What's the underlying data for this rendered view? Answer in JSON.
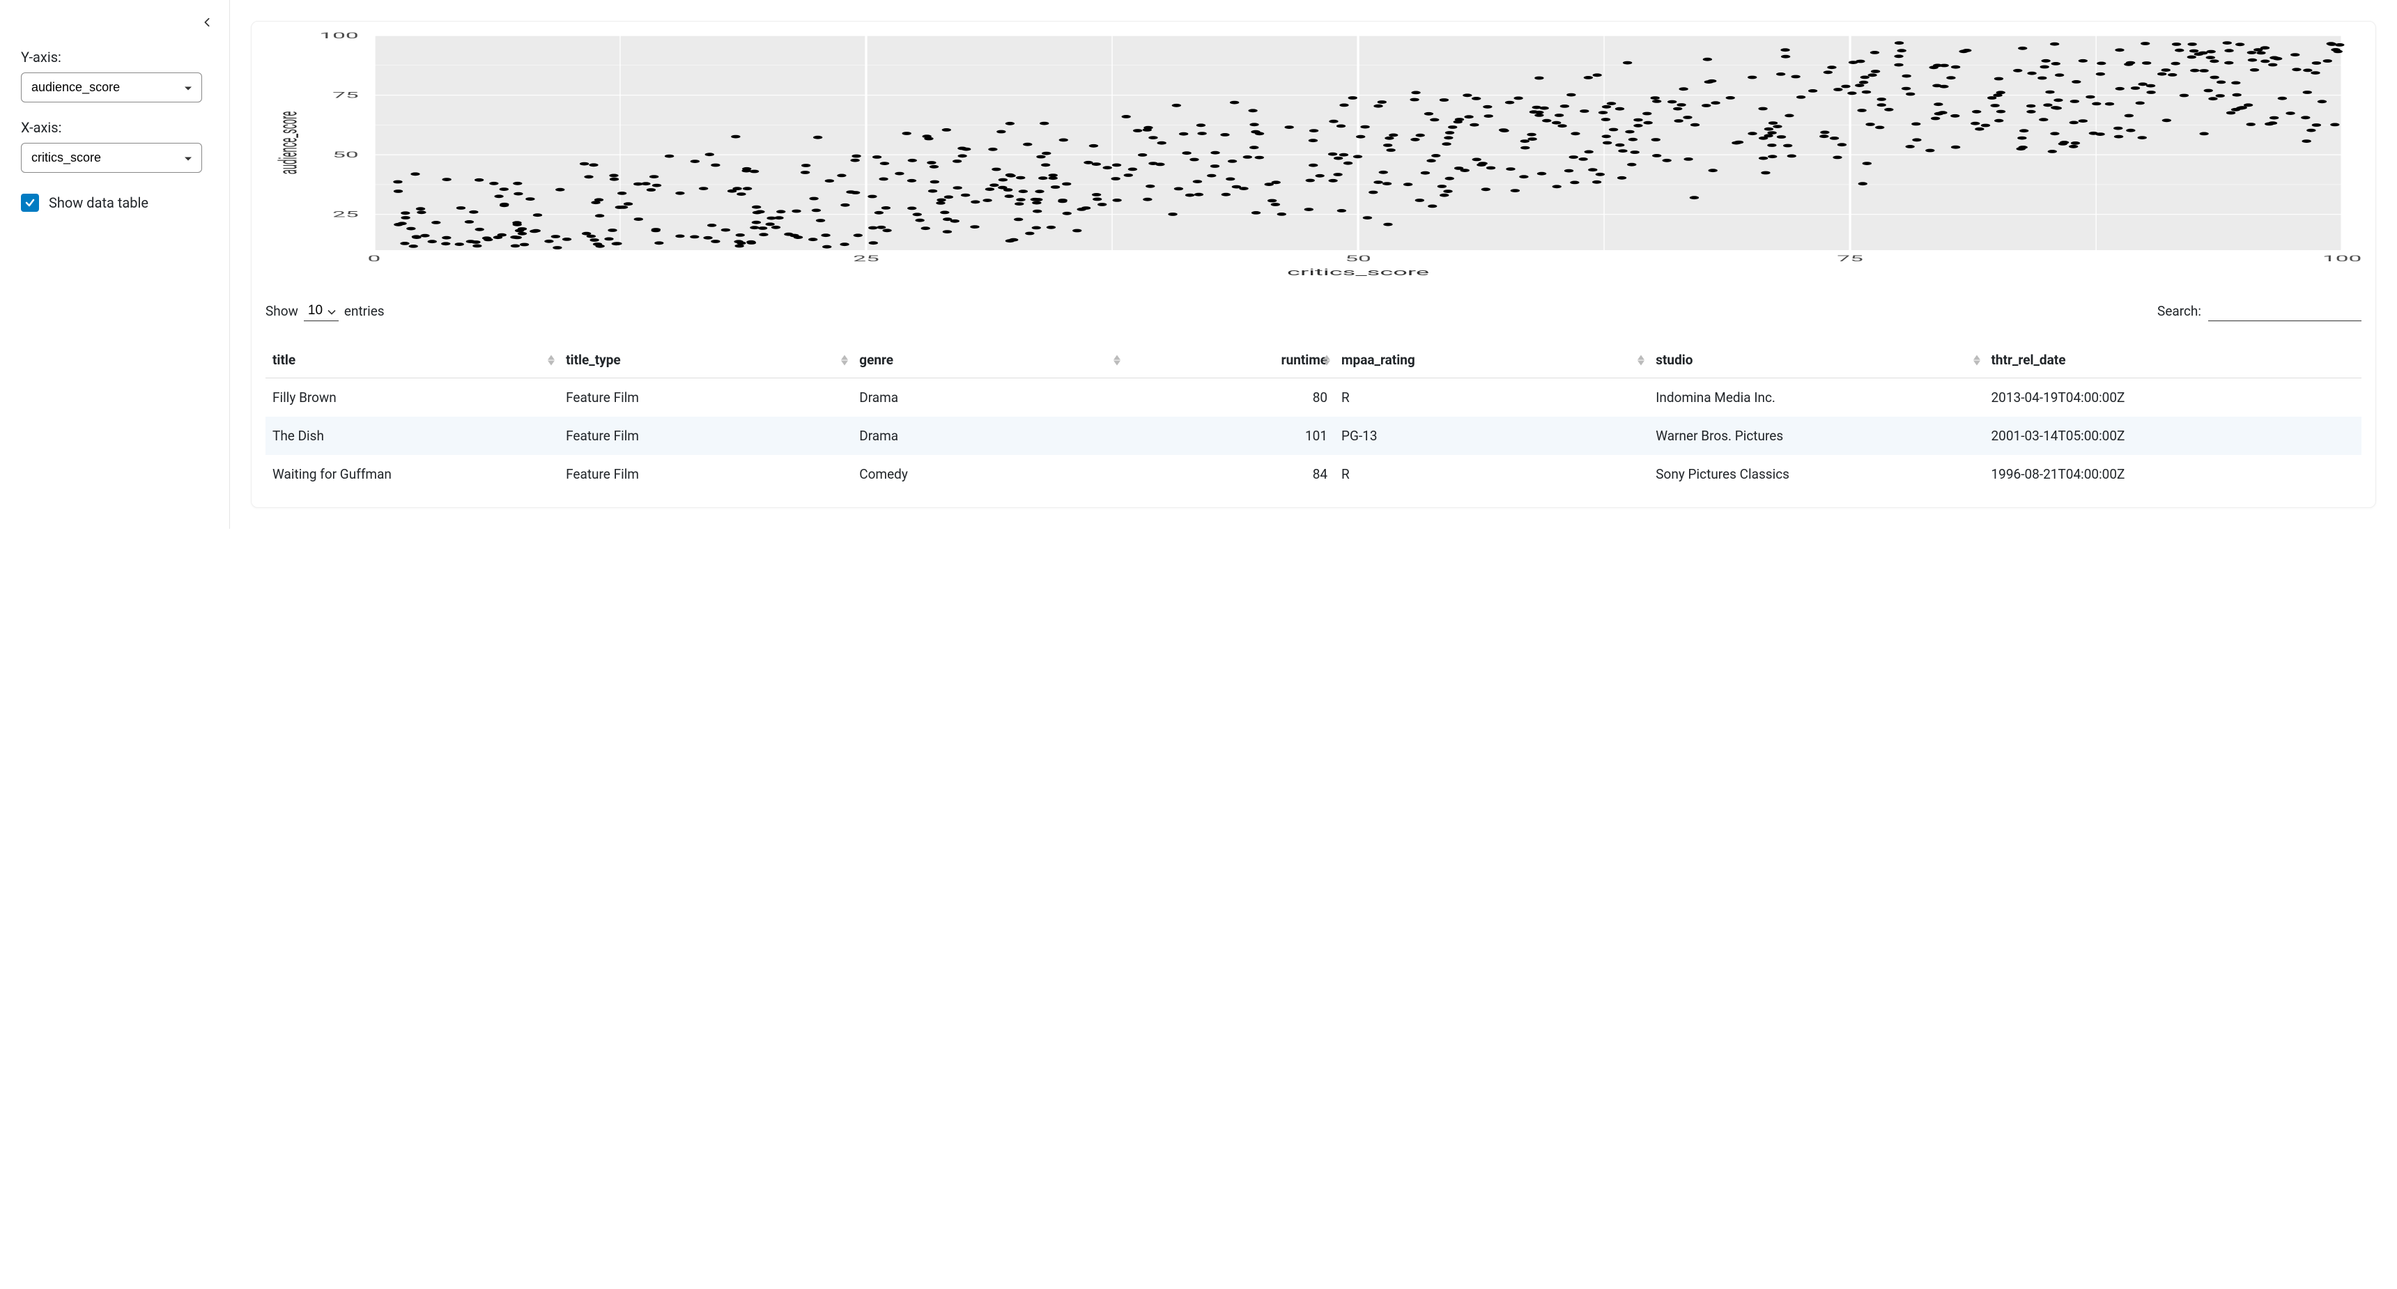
{
  "sidebar": {
    "y_axis": {
      "label": "Y-axis:",
      "value": "audience_score"
    },
    "x_axis": {
      "label": "X-axis:",
      "value": "critics_score"
    },
    "show_table": {
      "label": "Show data table",
      "checked": true
    }
  },
  "datatable": {
    "length": {
      "prefix": "Show",
      "value": "10",
      "suffix": "entries"
    },
    "search": {
      "label": "Search:",
      "value": ""
    },
    "columns": [
      "title",
      "title_type",
      "genre",
      "runtime",
      "mpaa_rating",
      "studio",
      "thtr_rel_date"
    ],
    "rows": [
      {
        "title": "Filly Brown",
        "title_type": "Feature Film",
        "genre": "Drama",
        "runtime": "80",
        "mpaa_rating": "R",
        "studio": "Indomina Media Inc.",
        "thtr_rel_date": "2013-04-19T04:00:00Z"
      },
      {
        "title": "The Dish",
        "title_type": "Feature Film",
        "genre": "Drama",
        "runtime": "101",
        "mpaa_rating": "PG-13",
        "studio": "Warner Bros. Pictures",
        "thtr_rel_date": "2001-03-14T05:00:00Z"
      },
      {
        "title": "Waiting for Guffman",
        "title_type": "Feature Film",
        "genre": "Comedy",
        "runtime": "84",
        "mpaa_rating": "R",
        "studio": "Sony Pictures Classics",
        "thtr_rel_date": "1996-08-21T04:00:00Z"
      }
    ]
  },
  "chart_data": {
    "type": "scatter",
    "xlabel": "critics_score",
    "ylabel": "audience_score",
    "xlim": [
      0,
      100
    ],
    "ylim": [
      10,
      100
    ],
    "x_ticks": [
      0,
      25,
      50,
      75,
      100
    ],
    "y_ticks": [
      25,
      50,
      75,
      100
    ],
    "n_points_approx": 650
  }
}
